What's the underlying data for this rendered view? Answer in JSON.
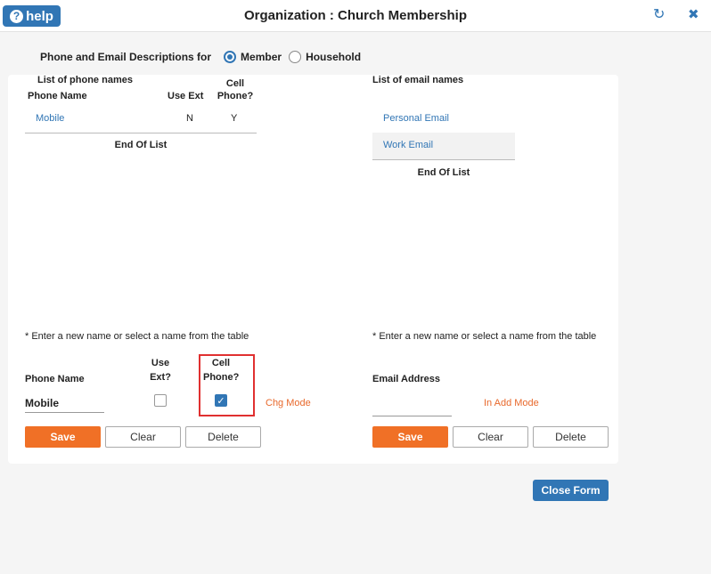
{
  "window": {
    "help_label": "help",
    "title": "Organization : Church Membership",
    "refresh_icon": "refresh-icon",
    "close_icon": "close-icon"
  },
  "descriptions": {
    "label": "Phone and Email Descriptions for",
    "options": [
      "Member",
      "Household"
    ],
    "selected": "Member"
  },
  "phone": {
    "list_title": "List of phone names",
    "headers": {
      "name": "Phone Name",
      "use_ext": "Use Ext",
      "cell_line1": "Cell",
      "cell_line2": "Phone?"
    },
    "rows": [
      {
        "name": "Mobile",
        "use_ext": "N",
        "cell": "Y"
      }
    ],
    "end_of_list": "End Of List",
    "hint": "* Enter a new name or select a name from the table",
    "form": {
      "name_label": "Phone Name",
      "use_ext_line1": "Use",
      "use_ext_line2": "Ext?",
      "cell_line1": "Cell",
      "cell_line2": "Phone?",
      "name_value": "Mobile",
      "use_ext_checked": false,
      "cell_checked": true,
      "mode": "Chg Mode"
    },
    "buttons": {
      "save": "Save",
      "clear": "Clear",
      "delete": "Delete"
    }
  },
  "email": {
    "list_title": "List of email names",
    "rows": [
      "Personal Email",
      "Work Email"
    ],
    "end_of_list": "End Of List",
    "hint": "* Enter a new name or select a name from the table",
    "form": {
      "address_label": "Email Address",
      "address_value": "",
      "mode": "In Add Mode"
    },
    "buttons": {
      "save": "Save",
      "clear": "Clear",
      "delete": "Delete"
    }
  },
  "footer": {
    "close_form": "Close Form"
  },
  "colors": {
    "accent_blue": "#3176b5",
    "accent_orange": "#f07026",
    "highlight_red": "#e03030"
  }
}
